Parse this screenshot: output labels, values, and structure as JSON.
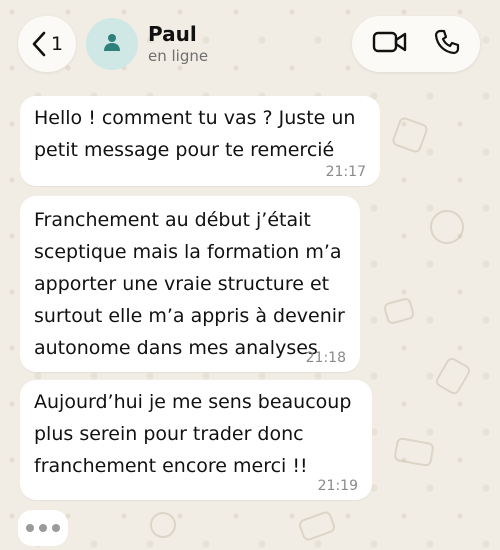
{
  "header": {
    "back_count": "1",
    "contact_name": "Paul",
    "contact_status": "en ligne",
    "icons": [
      "chevron-left-icon",
      "person-icon",
      "video-camera-icon",
      "phone-icon"
    ]
  },
  "messages": [
    {
      "text": "Hello ! comment tu vas ? Juste un\npetit message pour te remercié",
      "time": "21:17"
    },
    {
      "text": "Franchement au début j’était\nsceptique mais la formation m’a\napporter une vraie structure et\nsurtout elle m’a appris à devenir\nautonome dans mes analyses",
      "time": "21:18"
    },
    {
      "text": "Aujourd’hui je me sens beaucoup\nplus serein pour trader donc\nfranchement encore merci !!",
      "time": "21:19"
    }
  ],
  "typing_indicator": true,
  "colors": {
    "background": "#f1ede4",
    "bubble": "#ffffff",
    "avatar_bg": "#cfe8e6",
    "avatar_fg": "#2f7f7a"
  }
}
